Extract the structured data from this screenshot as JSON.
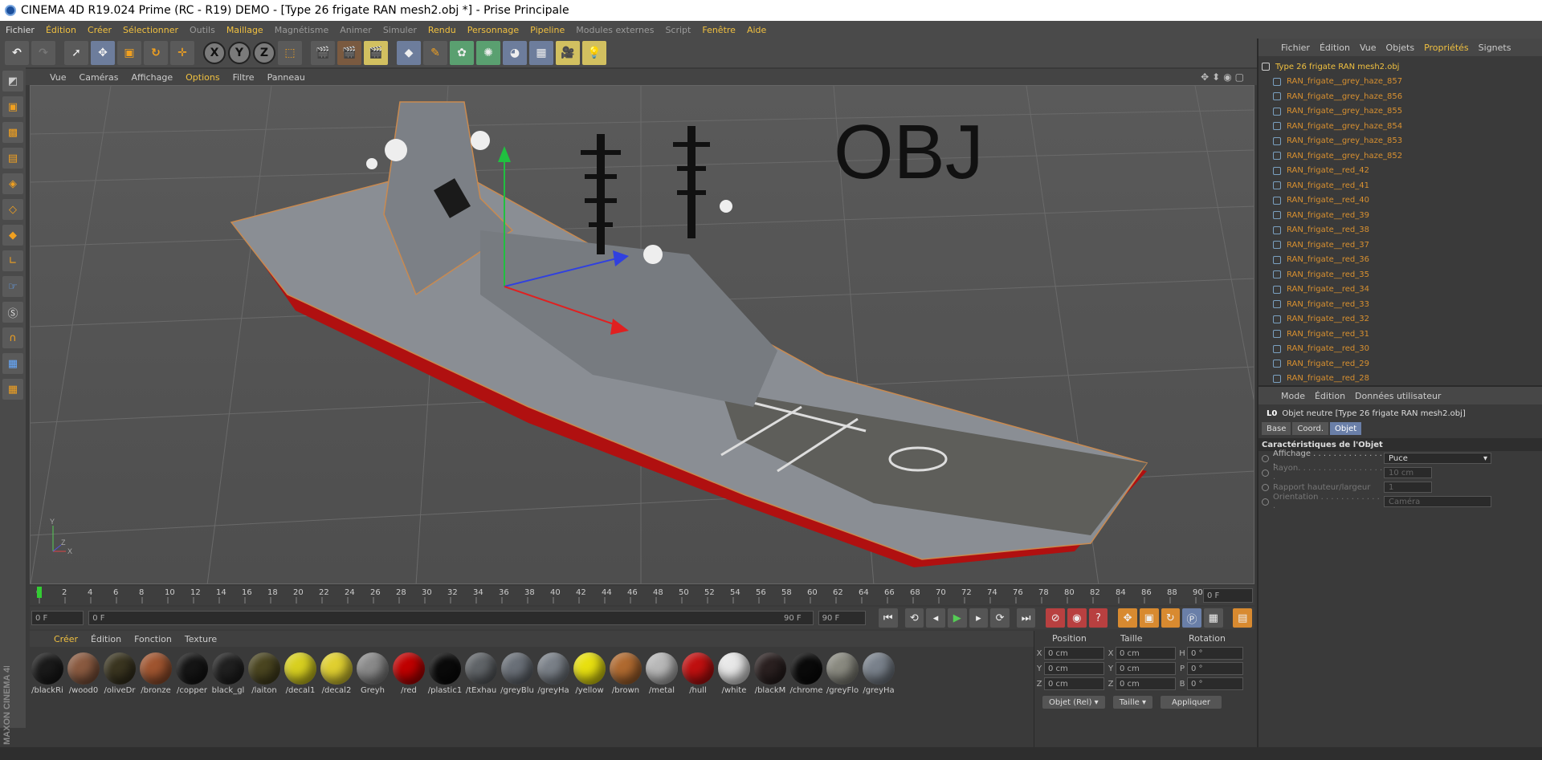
{
  "window": {
    "title": "CINEMA 4D R19.024 Prime (RC - R19) DEMO - [Type 26 frigate RAN mesh2.obj *] - Prise Principale"
  },
  "menu": [
    "Fichier",
    "Édition",
    "Créer",
    "Sélectionner",
    "Outils",
    "Maillage",
    "Magnétisme",
    "Animer",
    "Simuler",
    "Rendu",
    "Personnage",
    "Pipeline",
    "Modules externes",
    "Script",
    "Fenêtre",
    "Aide"
  ],
  "toolbar": {
    "x": "X",
    "y": "Y",
    "z": "Z"
  },
  "viewport": {
    "menu": [
      "Vue",
      "Caméras",
      "Affichage",
      "Options",
      "Filtre",
      "Panneau"
    ],
    "overlay_text": "OBJ",
    "axis": {
      "y": "Y",
      "z": "Z",
      "x": "X"
    }
  },
  "timeline": {
    "ticks": [
      "0",
      "2",
      "4",
      "6",
      "8",
      "10",
      "12",
      "14",
      "16",
      "18",
      "20",
      "22",
      "24",
      "26",
      "28",
      "30",
      "32",
      "34",
      "36",
      "38",
      "40",
      "42",
      "44",
      "46",
      "48",
      "50",
      "52",
      "54",
      "56",
      "58",
      "60",
      "62",
      "64",
      "66",
      "68",
      "70",
      "72",
      "74",
      "76",
      "78",
      "80",
      "82",
      "84",
      "86",
      "88",
      "90"
    ],
    "current_frame": "0 F"
  },
  "playback": {
    "start": "0 F",
    "range_start": "0 F",
    "range_end": "90 F",
    "end": "90 F"
  },
  "materials": {
    "menu": [
      "Créer",
      "Édition",
      "Fonction",
      "Texture"
    ],
    "items": [
      {
        "name": "/blackRi",
        "color": "#1a1a1a"
      },
      {
        "name": "/wood0",
        "color": "#8a5a40"
      },
      {
        "name": "/oliveDr",
        "color": "#3a3520"
      },
      {
        "name": "/bronze",
        "color": "#a05530"
      },
      {
        "name": "/copper",
        "color": "#151515"
      },
      {
        "name": "black_gl",
        "color": "#202020"
      },
      {
        "name": "/laiton",
        "color": "#4a4520"
      },
      {
        "name": "/decal1",
        "color": "#d8d020"
      },
      {
        "name": "/decal2",
        "color": "#e0d030"
      },
      {
        "name": "Greyh",
        "color": "#8a8a8a"
      },
      {
        "name": "/red",
        "color": "#c00000"
      },
      {
        "name": "/plastic1",
        "color": "#0a0a0a"
      },
      {
        "name": "/tExhau",
        "color": "#606468"
      },
      {
        "name": "/greyBlu",
        "color": "#6a7078"
      },
      {
        "name": "/greyHa",
        "color": "#7a8088"
      },
      {
        "name": "/yellow",
        "color": "#e8e010"
      },
      {
        "name": "/brown",
        "color": "#b06a30"
      },
      {
        "name": "/metal",
        "color": "#b8b8b8"
      },
      {
        "name": "/hull",
        "color": "#c01010"
      },
      {
        "name": "/white",
        "color": "#e8e8e8"
      },
      {
        "name": "/blackM",
        "color": "#2a2020"
      },
      {
        "name": "/chrome",
        "color": "#0a0a0a"
      },
      {
        "name": "/greyFlo",
        "color": "#8a8a80"
      },
      {
        "name": "/greyHa",
        "color": "#7a828c"
      }
    ]
  },
  "coords": {
    "headers": [
      "Position",
      "Taille",
      "Rotation"
    ],
    "rows": [
      {
        "axis": "X",
        "pos": "0 cm",
        "size_axis": "X",
        "size": "0 cm",
        "rot_axis": "H",
        "rot": "0 °"
      },
      {
        "axis": "Y",
        "pos": "0 cm",
        "size_axis": "Y",
        "size": "0 cm",
        "rot_axis": "P",
        "rot": "0 °"
      },
      {
        "axis": "Z",
        "pos": "0 cm",
        "size_axis": "Z",
        "size": "0 cm",
        "rot_axis": "B",
        "rot": "0 °"
      }
    ],
    "mode": "Objet (Rel)",
    "size_mode": "Taille",
    "apply": "Appliquer"
  },
  "objects": {
    "menu": [
      "Fichier",
      "Édition",
      "Vue",
      "Objets",
      "Propriétés",
      "Signets"
    ],
    "root": "Type 26 frigate RAN mesh2.obj",
    "items": [
      "RAN_frigate__grey_haze_857",
      "RAN_frigate__grey_haze_856",
      "RAN_frigate__grey_haze_855",
      "RAN_frigate__grey_haze_854",
      "RAN_frigate__grey_haze_853",
      "RAN_frigate__grey_haze_852",
      "RAN_frigate__red_42",
      "RAN_frigate__red_41",
      "RAN_frigate__red_40",
      "RAN_frigate__red_39",
      "RAN_frigate__red_38",
      "RAN_frigate__red_37",
      "RAN_frigate__red_36",
      "RAN_frigate__red_35",
      "RAN_frigate__red_34",
      "RAN_frigate__red_33",
      "RAN_frigate__red_32",
      "RAN_frigate__red_31",
      "RAN_frigate__red_30",
      "RAN_frigate__red_29",
      "RAN_frigate__red_28"
    ]
  },
  "attributes": {
    "menu": [
      "Mode",
      "Édition",
      "Données utilisateur"
    ],
    "header": "Objet neutre [Type 26 frigate RAN mesh2.obj]",
    "tabs": [
      "Base",
      "Coord.",
      "Objet"
    ],
    "section": "Caractéristiques de l'Objet",
    "rows": [
      {
        "label": "Affichage . . . . . . . . . . . . . . .",
        "value": "Puce"
      },
      {
        "label": "Rayon. . . . . . . . . . . . . . . . . .",
        "value": "10 cm"
      },
      {
        "label": "Rapport hauteur/largeur",
        "value": "1"
      },
      {
        "label": "Orientation . . . . . . . . . . . . .",
        "value": "Caméra"
      }
    ]
  },
  "branding": "MAXON CINEMA 4D"
}
